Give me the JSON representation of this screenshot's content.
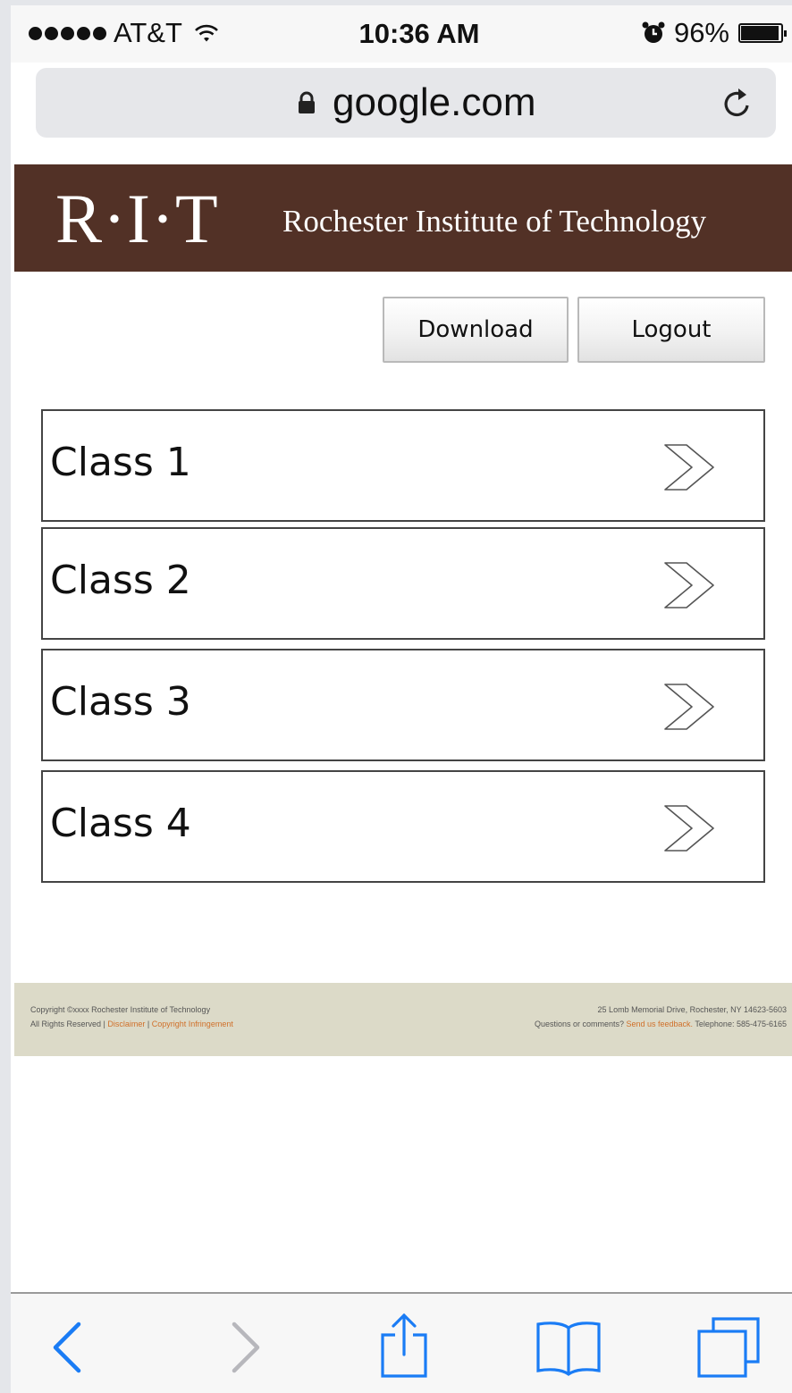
{
  "status_bar": {
    "carrier": "AT&T",
    "time": "10:36 AM",
    "battery": "96%",
    "icons": [
      "signal-dots-icon",
      "wifi-icon",
      "alarm-icon",
      "battery-icon"
    ]
  },
  "address_bar": {
    "url": "google.com",
    "icons": [
      "lock-icon",
      "reload-icon"
    ]
  },
  "header": {
    "logo": "R·I·T",
    "institution": "Rochester Institute of Technology",
    "background_color": "#523126"
  },
  "actions": {
    "download_label": "Download",
    "logout_label": "Logout"
  },
  "classes": [
    {
      "label": "Class 1"
    },
    {
      "label": "Class 2"
    },
    {
      "label": "Class 3"
    },
    {
      "label": "Class 4"
    }
  ],
  "footer": {
    "copyright": "Copyright ©xxxx Rochester Institute of Technology",
    "rights": "All Rights Reserved |",
    "disclaimer_link": "Disclaimer",
    "separator": "|",
    "copyright_link": "Copyright Infringement",
    "address": "25 Lomb Memorial Drive, Rochester, NY 14623-5603",
    "questions": "Questions or comments?",
    "feedback_link": "Send us feedback.",
    "telephone": "Telephone: 585-475-6165",
    "background_color": "#dcdac8",
    "link_color": "#d0702a"
  },
  "toolbar": {
    "icons": [
      "back-icon",
      "forward-icon",
      "share-icon",
      "bookmarks-icon",
      "tabs-icon"
    ],
    "accent_color": "#1a7cf5"
  }
}
